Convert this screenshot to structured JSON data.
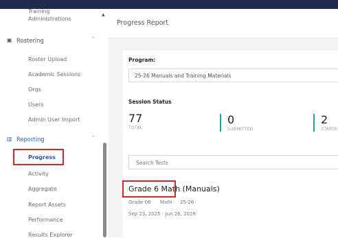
{
  "sidebar": {
    "training_line1": "Training",
    "training_line2": "Administrations",
    "rostering": {
      "label": "Rostering",
      "items": [
        "Roster Upload",
        "Academic Sessions",
        "Orgs",
        "Users",
        "Admin User Import"
      ]
    },
    "reporting": {
      "label": "Reporting",
      "items": [
        "Progress",
        "Activity",
        "Aggregate",
        "Report Assets",
        "Performance",
        "Results Explorer"
      ]
    }
  },
  "header": {
    "title": "Progress Report"
  },
  "program": {
    "label": "Program:",
    "selected": "25-26 Manuals and Training Materials"
  },
  "session_status": {
    "label": "Session Status",
    "stats": [
      {
        "value": "77",
        "caption": "TOTAL"
      },
      {
        "value": "0",
        "caption": "SUBMITTED"
      },
      {
        "value": "2",
        "caption": "STARTE"
      }
    ]
  },
  "search": {
    "placeholder": "Search Tests"
  },
  "test": {
    "title": "Grade 6 Math (Manuals)",
    "grade": "Grade 06",
    "subject": "Math",
    "year": "25-26",
    "dates": "Sep 23, 2025 - Jun 26, 2026"
  },
  "colors": {
    "accent": "#2a64c8",
    "highlight": "#d62728",
    "stat_bar": "#1aa99a",
    "topbar": "#1f2b4c"
  }
}
